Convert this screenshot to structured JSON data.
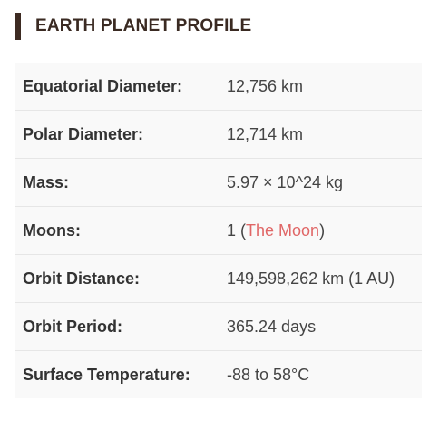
{
  "header": {
    "title": "EARTH PLANET PROFILE"
  },
  "rows": [
    {
      "label": "Equatorial Diameter:",
      "value": "12,756 km"
    },
    {
      "label": "Polar Diameter:",
      "value": "12,714 km"
    },
    {
      "label": "Mass:",
      "value": "5.97 × 10^24 kg"
    },
    {
      "label": "Moons:",
      "value_prefix": "1 (",
      "link_text": "The Moon",
      "value_suffix": ")"
    },
    {
      "label": "Orbit Distance:",
      "value": "149,598,262 km (1 AU)"
    },
    {
      "label": "Orbit Period:",
      "value": "365.24 days"
    },
    {
      "label": "Surface Temperature:",
      "value": "-88 to 58°C"
    }
  ],
  "colors": {
    "accent_bar": "#3d2b22",
    "link": "#e06666",
    "table_background": "#f9f9f9"
  }
}
